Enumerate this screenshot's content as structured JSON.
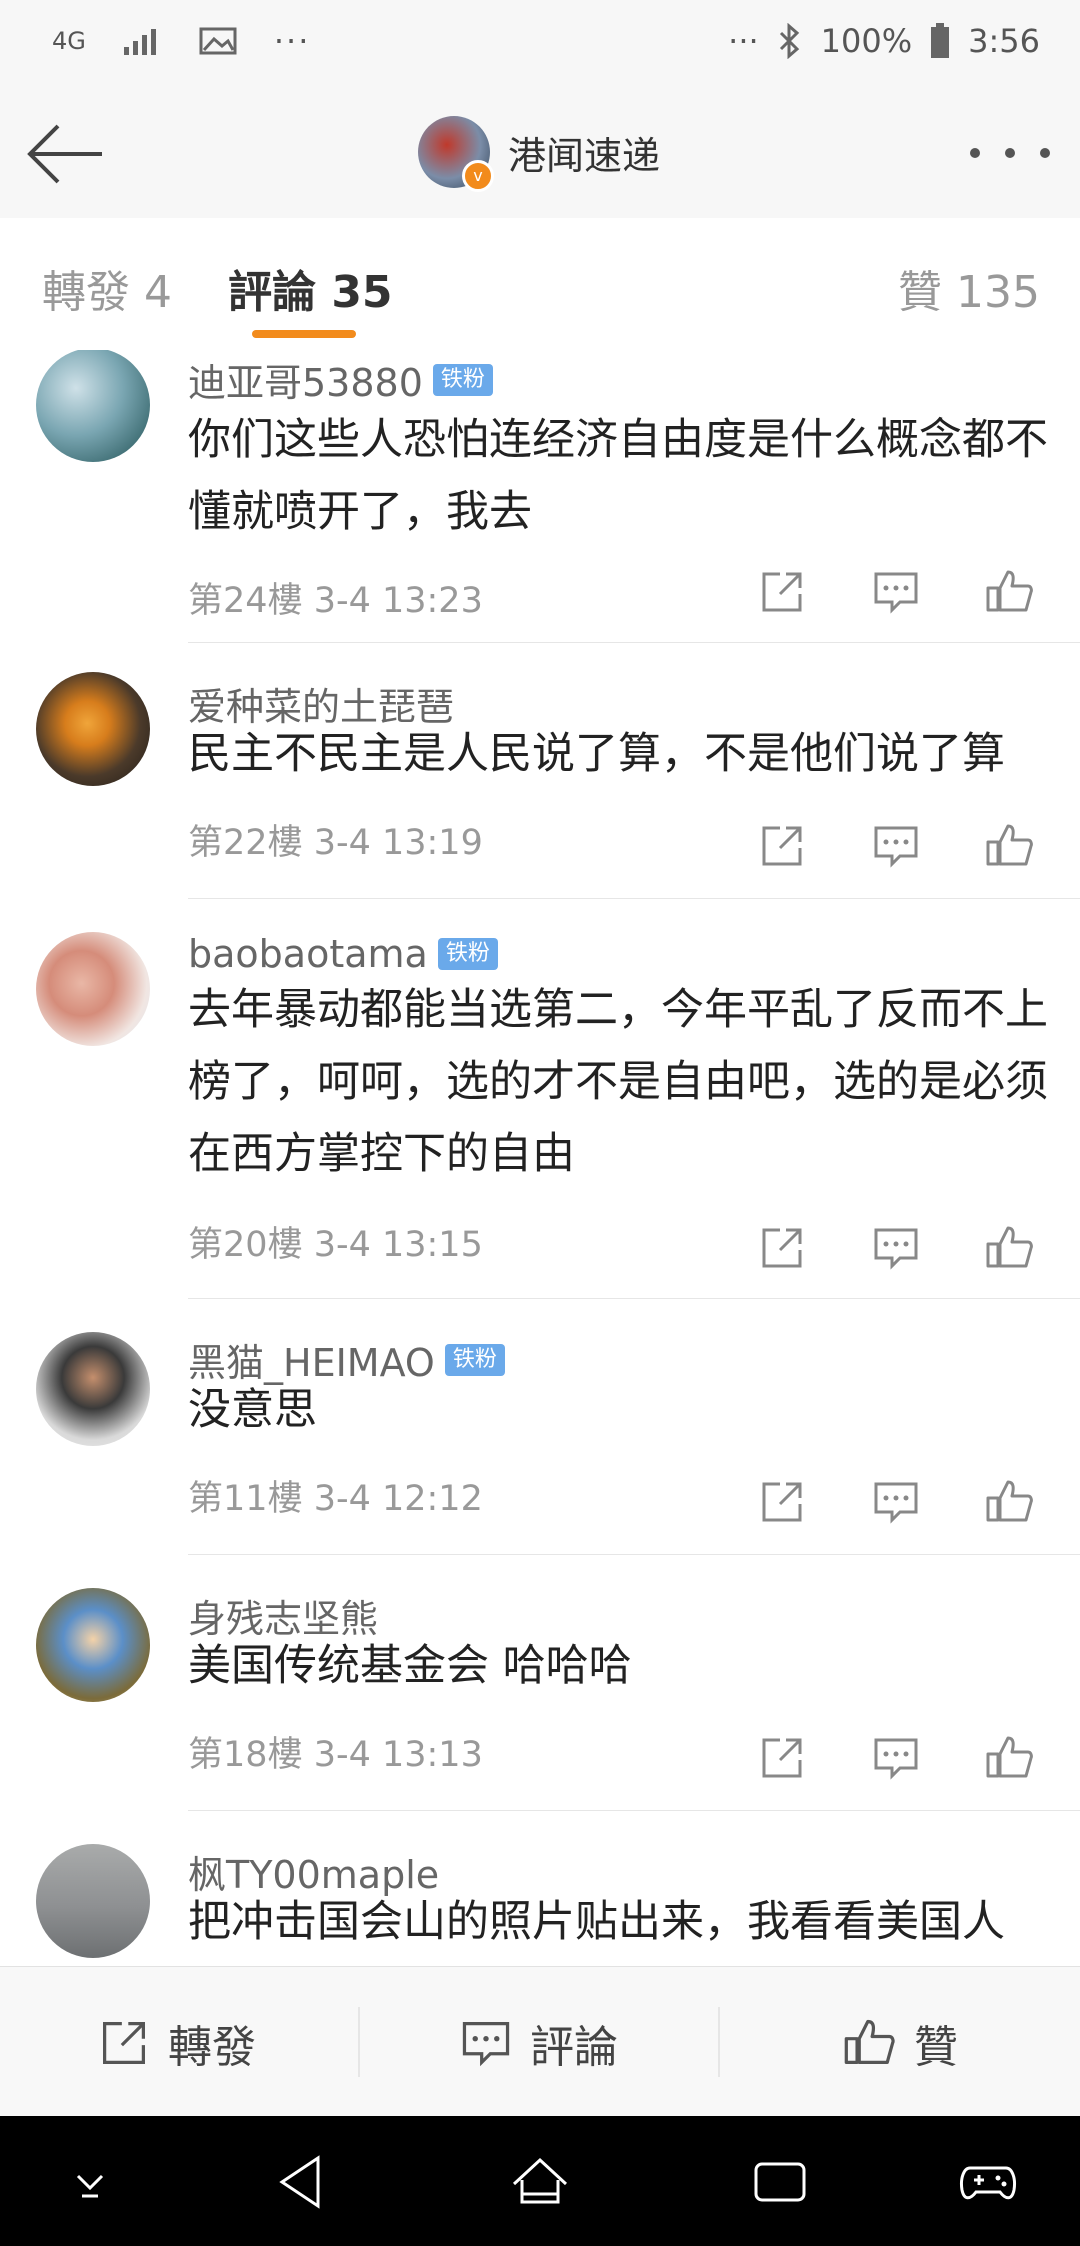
{
  "status_bar": {
    "network": "4G",
    "battery": "100%",
    "time": "3:56",
    "icons": [
      "signal-icon",
      "image-icon",
      "more-dots-icon",
      "bluetooth-icon",
      "battery-icon"
    ]
  },
  "nav": {
    "title": "港闻速递",
    "verified_badge": "v"
  },
  "tabs": {
    "forward": "轉發 4",
    "comment": "評論 35",
    "like": "贊 135"
  },
  "comments": [
    {
      "user": "迪亚哥53880",
      "badge": "铁粉",
      "text": "你们这些人恐怕连经济自由度是什么概念都不懂就喷开了，我去",
      "floor": "第24樓",
      "time": "3-4 13:23"
    },
    {
      "user": "爱种菜的土琵琶",
      "badge": "",
      "text": "民主不民主是人民说了算，不是他们说了算",
      "floor": "第22樓",
      "time": "3-4 13:19"
    },
    {
      "user": "baobaotama",
      "badge": "铁粉",
      "text": "去年暴动都能当选第二，今年平乱了反而不上榜了，呵呵，选的才不是自由吧，选的是必须在西方掌控下的自由",
      "floor": "第20樓",
      "time": "3-4 13:15"
    },
    {
      "user": "黑猫_HEIMAO",
      "badge": "铁粉",
      "text": "没意思",
      "floor": "第11樓",
      "time": "3-4 12:12"
    },
    {
      "user": "身残志坚熊",
      "badge": "",
      "text": "美国传统基金会 哈哈哈",
      "floor": "第18樓",
      "time": "3-4 13:13"
    },
    {
      "user": "枫TY00maple",
      "badge": "",
      "text": "把冲击国会山的照片贴出来，我看看美国人",
      "floor": "",
      "time": ""
    }
  ],
  "bottom_bar": {
    "forward": "轉發",
    "comment": "評論",
    "like": "贊"
  },
  "colors": {
    "accent": "#f28b1c",
    "fan_badge": "#6aa9ea",
    "bar_bg": "#f7f7f7",
    "android_nav": "#000000"
  }
}
